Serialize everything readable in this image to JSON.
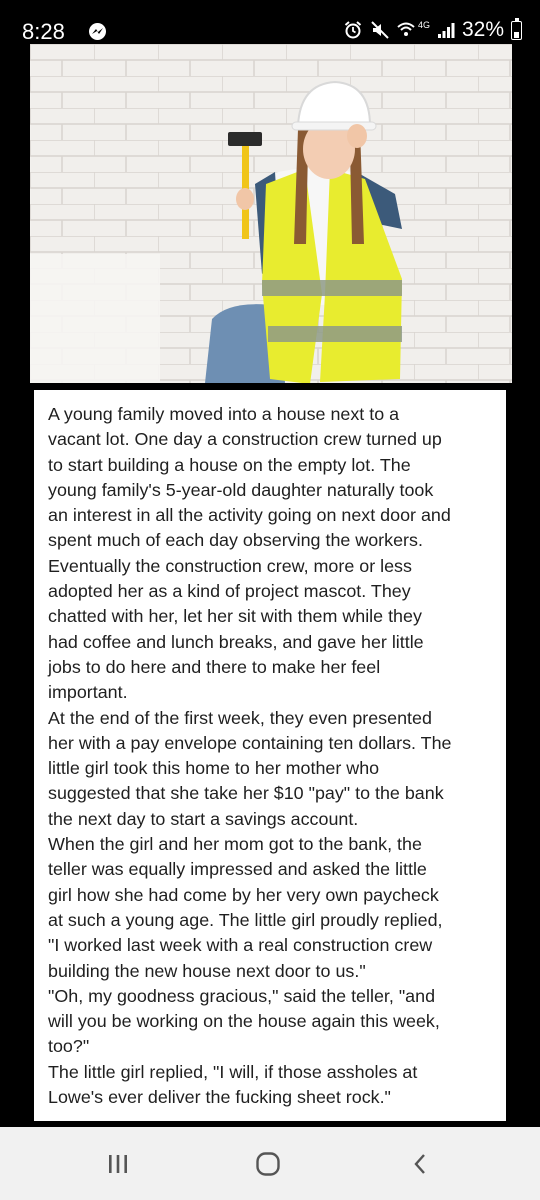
{
  "status_bar": {
    "time": "8:28",
    "network": "4G",
    "battery": "32%",
    "icons": [
      "messenger-icon",
      "alarm-icon",
      "mute-icon",
      "wifi-icon",
      "signal-icon",
      "battery-icon"
    ]
  },
  "post": {
    "image": {
      "subject": "girl-in-hard-hat-with-hammer",
      "icon": "photo"
    },
    "story_lines": [
      "A young family moved into a house next to a",
      "vacant lot. One day a construction crew turned up",
      "to start building a house on the empty lot. The",
      "young family's 5-year-old daughter naturally took",
      "an interest in all the activity going on next door and",
      "spent much of each day observing the workers.",
      "Eventually the construction crew, more or less",
      "adopted her as a kind of project mascot. They",
      "chatted with her, let her sit with them while they",
      "had coffee and lunch breaks, and gave her little",
      "jobs to do here and there to make her feel",
      "important.",
      "At the end of the first week, they even presented",
      "her with a pay envelope containing ten dollars. The",
      "little girl took this home to her mother who",
      "suggested that she take her $10 \"pay\" to the bank",
      "the next day to start a savings account.",
      "When the girl and her mom got to the bank, the",
      "teller was equally impressed and asked the little",
      "girl how she had come by her very own paycheck",
      "at such a young age. The little girl proudly replied,",
      "\"I worked last week with a real construction crew",
      "building the new house next door to us.\"",
      "\"Oh, my goodness gracious,\" said the teller, \"and",
      "will you be working on the house again this week,",
      "too?\"",
      "The little girl replied, \"I will, if those assholes at",
      "Lowe's ever deliver the fucking sheet rock.\""
    ]
  },
  "nav_bar": {
    "buttons": [
      "recent-apps-icon",
      "home-icon",
      "back-icon"
    ]
  },
  "colors": {
    "status_bg": "#000000",
    "card_bg": "#ffffff",
    "text": "#1f1f1f",
    "nav_bg": "#f1f1f1",
    "vest": "#e8ec2f"
  }
}
